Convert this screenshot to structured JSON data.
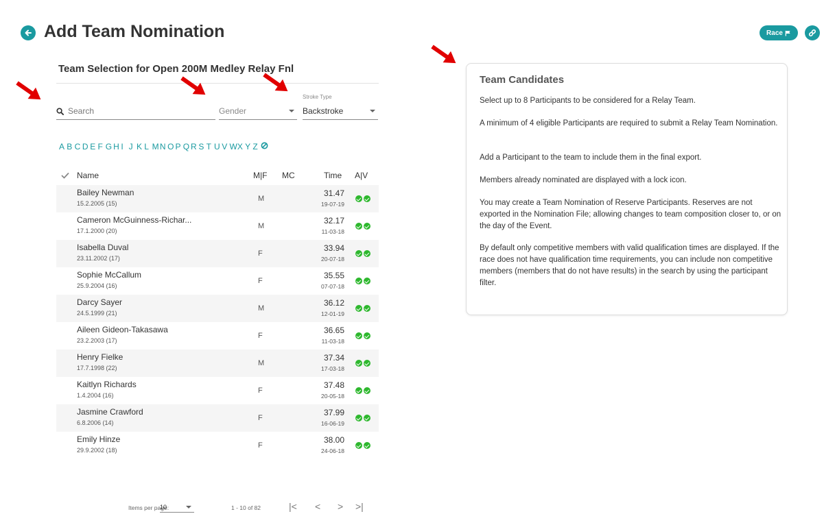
{
  "header": {
    "title": "Add Team Nomination",
    "race_label": "Race"
  },
  "selection": {
    "title": "Team Selection for Open 200M Medley Relay Fnl",
    "search_placeholder": "Search",
    "gender_placeholder": "Gender",
    "stroke_label": "Stroke Type",
    "stroke_value": "Backstroke"
  },
  "alphabet": [
    "A",
    "B",
    "C",
    "D",
    "E",
    "F",
    "G",
    "H",
    "I",
    "J",
    "K",
    "L",
    "M",
    "N",
    "O",
    "P",
    "Q",
    "R",
    "S",
    "T",
    "U",
    "V",
    "W",
    "X",
    "Y",
    "Z"
  ],
  "table": {
    "headers": {
      "name": "Name",
      "mf": "M|F",
      "mc": "MC",
      "time": "Time",
      "av": "A|V"
    },
    "rows": [
      {
        "name": "Bailey Newman",
        "dob": "15.2.2005 (15)",
        "sex": "M",
        "time": "31.47",
        "date": "19-07-19"
      },
      {
        "name": "Cameron McGuinness-Richar...",
        "dob": "17.1.2000 (20)",
        "sex": "M",
        "time": "32.17",
        "date": "11-03-18"
      },
      {
        "name": "Isabella Duval",
        "dob": "23.11.2002 (17)",
        "sex": "F",
        "time": "33.94",
        "date": "20-07-18"
      },
      {
        "name": "Sophie McCallum",
        "dob": "25.9.2004 (16)",
        "sex": "F",
        "time": "35.55",
        "date": "07-07-18"
      },
      {
        "name": "Darcy Sayer",
        "dob": "24.5.1999 (21)",
        "sex": "M",
        "time": "36.12",
        "date": "12-01-19"
      },
      {
        "name": "Aileen Gideon-Takasawa",
        "dob": "23.2.2003 (17)",
        "sex": "F",
        "time": "36.65",
        "date": "11-03-18"
      },
      {
        "name": "Henry Fielke",
        "dob": "17.7.1998 (22)",
        "sex": "M",
        "time": "37.34",
        "date": "17-03-18"
      },
      {
        "name": "Kaitlyn Richards",
        "dob": "1.4.2004 (16)",
        "sex": "F",
        "time": "37.48",
        "date": "20-05-18"
      },
      {
        "name": "Jasmine Crawford",
        "dob": "6.8.2006 (14)",
        "sex": "F",
        "time": "37.99",
        "date": "16-06-19"
      },
      {
        "name": "Emily Hinze",
        "dob": "29.9.2002 (18)",
        "sex": "F",
        "time": "38.00",
        "date": "24-06-18"
      }
    ]
  },
  "pager": {
    "items_label": "Items per page:",
    "page_size": "10",
    "range": "1 - 10 of 82"
  },
  "candidates": {
    "title": "Team Candidates",
    "paragraphs": [
      "Select up to 8 Participants to be considered for a Relay Team.",
      "A minimum of 4 eligible Participants are required to submit a Relay Team Nomination.",
      "Add a Participant to the team to include them in the final export.",
      "Members already nominated are displayed with a lock icon.",
      "You may create a Team Nomination of Reserve Participants. Reserves are not exported in the Nomination File; allowing changes to team composition closer to, or on the day of the Event.",
      "By default only competitive members with valid qualification times are displayed. If the race does not have qualification time requirements, you can include non competitive members (members that do not have results) in the search by using the participant filter."
    ]
  },
  "colors": {
    "accent": "#1a9aa0",
    "check": "#2eb82e",
    "annotation_arrow": "#e10000"
  }
}
